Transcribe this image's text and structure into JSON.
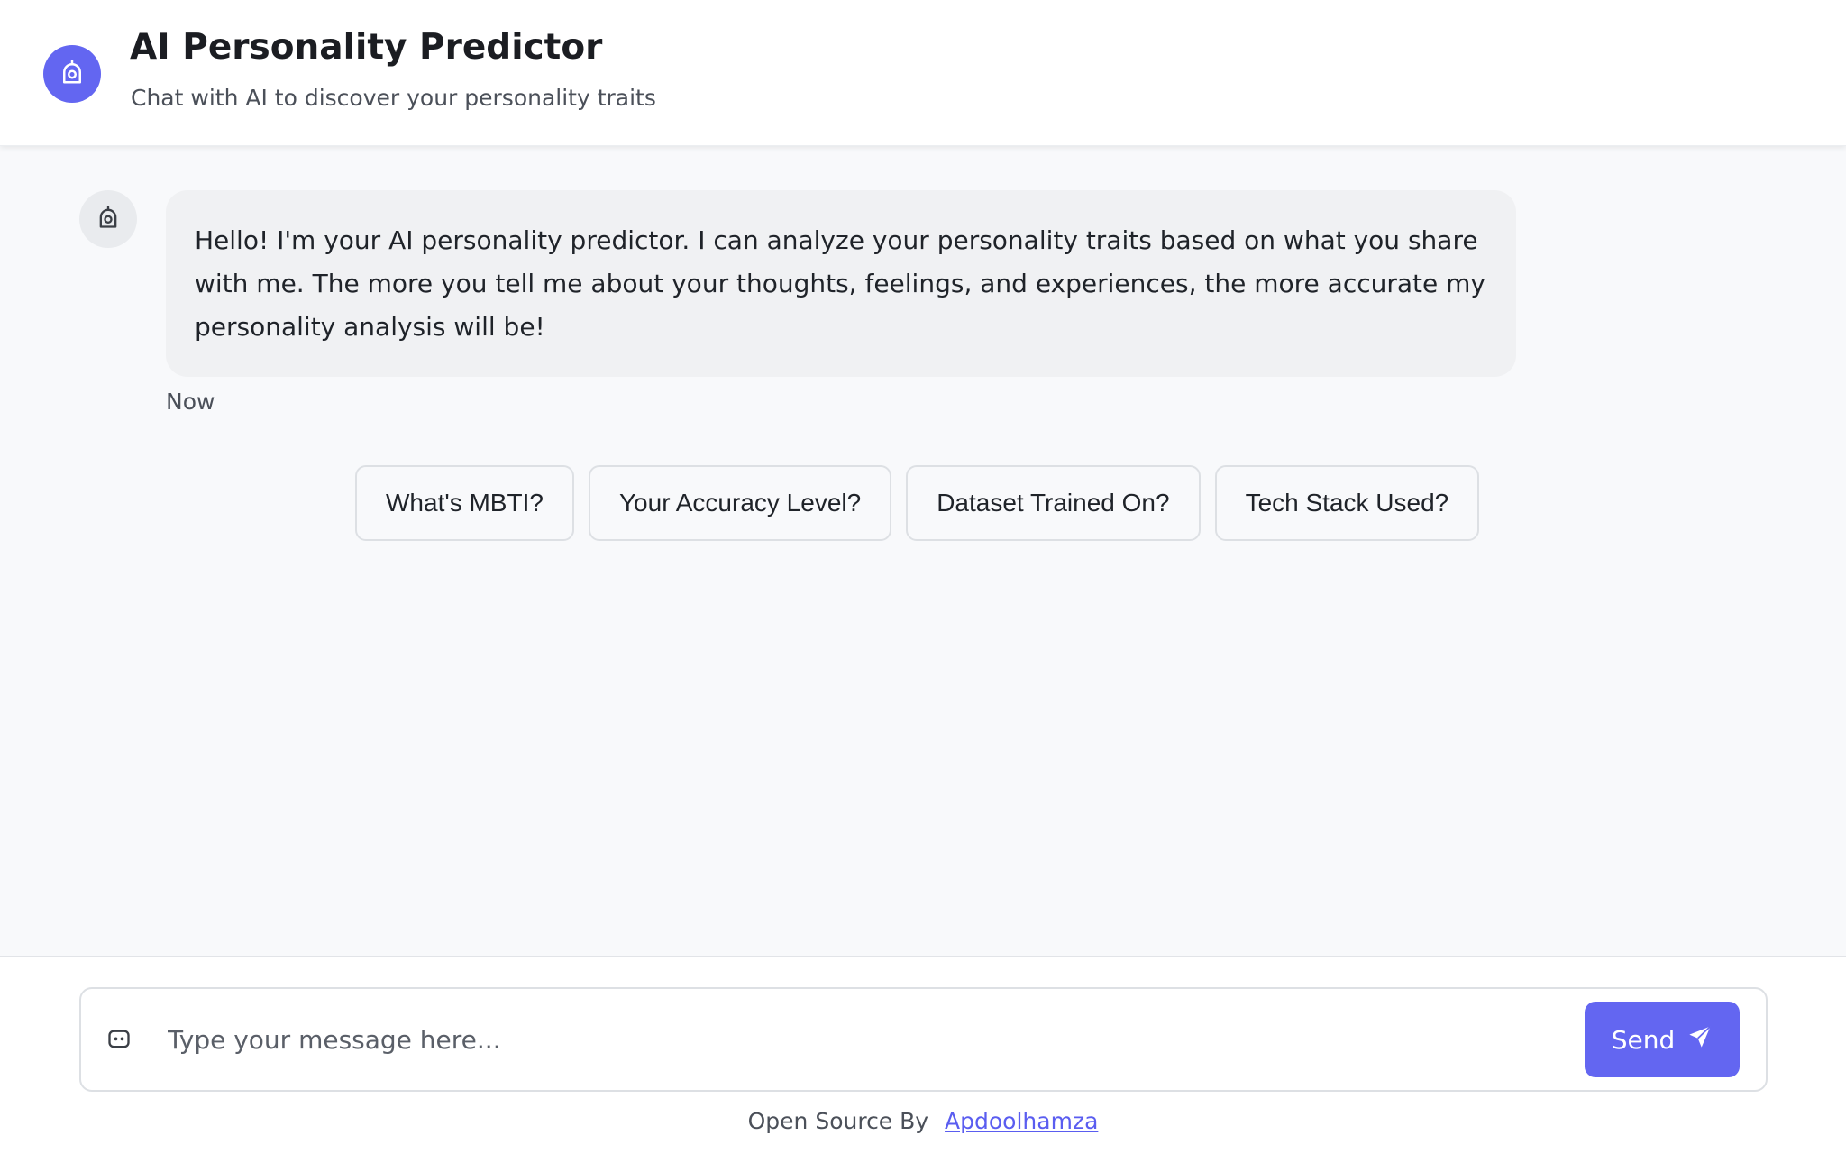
{
  "colors": {
    "accent": "#6366f1",
    "background": "#f8f9fb",
    "bubble": "#f0f1f3"
  },
  "header": {
    "logo_icon": "robot-icon",
    "title": "AI Personality Predictor",
    "subtitle": "Chat with AI to discover your personality traits"
  },
  "chat": {
    "avatar_icon": "robot-icon",
    "messages": [
      {
        "sender": "bot",
        "text": "Hello! I'm your AI personality predictor. I can analyze your personality traits based on what you share with me. The more you tell me about your thoughts, feelings, and experiences, the more accurate my personality analysis will be!",
        "time": "Now"
      }
    ],
    "suggestions": [
      "What's MBTI?",
      "Your Accuracy Level?",
      "Dataset Trained On?",
      "Tech Stack Used?"
    ]
  },
  "composer": {
    "icon": "chat-bubble-icon",
    "placeholder": "Type your message here...",
    "value": "",
    "send_label": "Send",
    "send_icon": "send-icon"
  },
  "footer": {
    "credit_prefix": "Open Source By",
    "credit_link": "Apdoolhamza"
  }
}
